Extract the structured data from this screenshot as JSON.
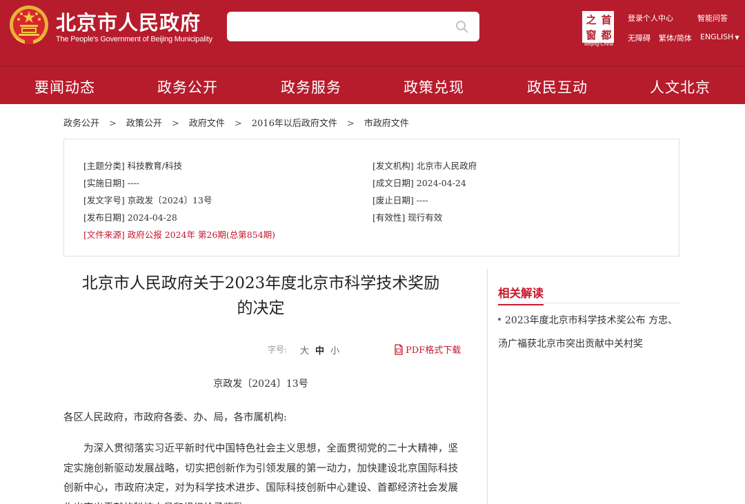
{
  "header": {
    "site_name_cn": "北京市人民政府",
    "site_name_en": "The People's Government of Beijing Municipality",
    "search_placeholder": "",
    "capital_logo": {
      "chars": [
        "之",
        "首",
        "窗",
        "都"
      ],
      "caption": "Beijing-China"
    },
    "links": {
      "login": "登录个人中心",
      "qa": "智能问答",
      "accessible": "无障碍",
      "trad_simplified": "繁体/简体",
      "english": "ENGLISH"
    },
    "colors": {
      "brand": "#b71c2c",
      "accent_red": "#c5172b"
    }
  },
  "nav": [
    "要闻动态",
    "政务公开",
    "政务服务",
    "政策兑现",
    "政民互动",
    "人文北京"
  ],
  "breadcrumb": [
    "政务公开",
    "政策公开",
    "政府文件",
    "2016年以后政府文件",
    "市政府文件"
  ],
  "breadcrumb_sep": ">",
  "meta": {
    "left": [
      {
        "label": "[主题分类]",
        "value": "科技教育/科技"
      },
      {
        "label": "[实施日期]",
        "value": "----"
      },
      {
        "label": "[发文字号]",
        "value": "京政发〔2024〕13号"
      },
      {
        "label": "[发布日期]",
        "value": "2024-04-28"
      }
    ],
    "right": [
      {
        "label": "[发文机构]",
        "value": "北京市人民政府"
      },
      {
        "label": "[成文日期]",
        "value": "2024-04-24"
      },
      {
        "label": "[废止日期]",
        "value": "----"
      },
      {
        "label": "[有效性]",
        "value": "现行有效"
      }
    ],
    "source": {
      "label": "[文件来源]",
      "value": "政府公报 2024年 第26期(总第854期)"
    }
  },
  "article": {
    "title_line1": "北京市人民政府关于2023年度北京市科学技术奖励",
    "title_line2": "的决定",
    "fontsize_label": "字号:",
    "fontsize_options": [
      "大",
      "中",
      "小"
    ],
    "pdf_label": "PDF格式下载",
    "doc_number": "京政发〔2024〕13号",
    "addressee": "各区人民政府，市政府各委、办、局，各市属机构:",
    "paragraph1": "为深入贯彻落实习近平新时代中国特色社会主义思想，全面贯彻党的二十大精神，坚定实施创新驱动发展战略，切实把创新作为引领发展的第一动力，加快建设北京国际科技创新中心，市政府决定，对为科学技术进步、国际科技创新中心建设、首都经济社会发展作出突出贡献的科技人员和组织给予奖励。"
  },
  "sidebar": {
    "title": "相关解读",
    "items": [
      "2023年度北京市科学技术奖公布 方忠、汤广福获北京市突出贡献中关村奖"
    ]
  }
}
